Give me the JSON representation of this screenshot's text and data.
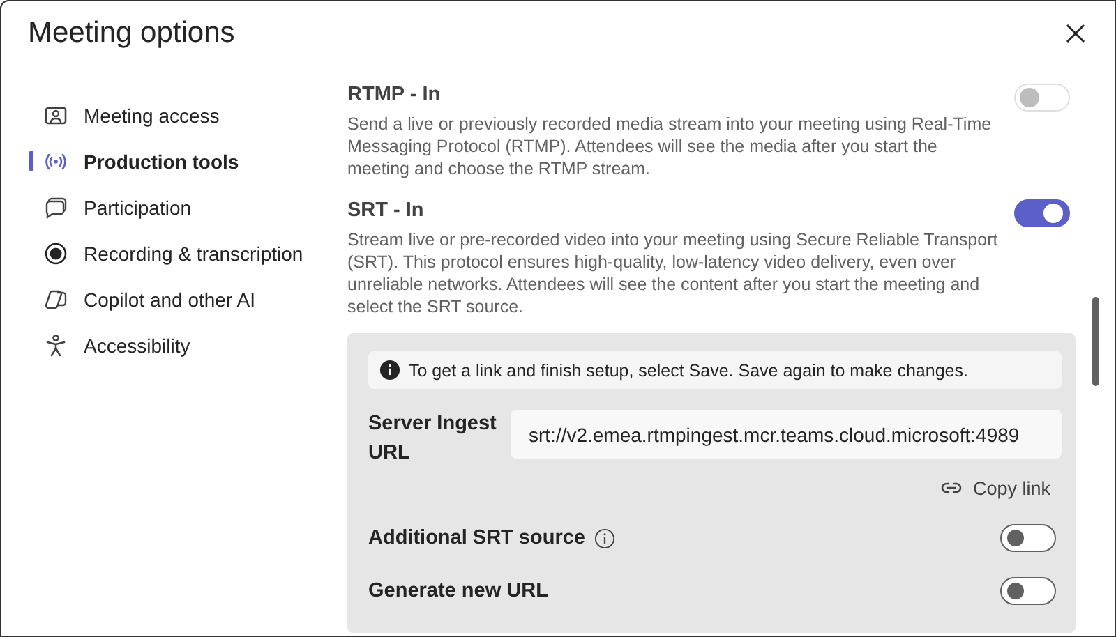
{
  "window": {
    "title": "Meeting options"
  },
  "sidebar": {
    "items": [
      {
        "label": "Meeting access",
        "kind": "access",
        "selected": false
      },
      {
        "label": "Production tools",
        "kind": "production",
        "selected": true
      },
      {
        "label": "Participation",
        "kind": "participation",
        "selected": false
      },
      {
        "label": "Recording & transcription",
        "kind": "recording",
        "selected": false
      },
      {
        "label": "Copilot and other AI",
        "kind": "ai",
        "selected": false
      },
      {
        "label": "Accessibility",
        "kind": "accessibility",
        "selected": false
      }
    ]
  },
  "sections": [
    {
      "title": "RTMP - In",
      "description": "Send a live or previously recorded media stream into your meeting using Real-Time Messaging Protocol (RTMP). Attendees will see the media after you start the meeting and choose the RTMP stream.",
      "on": false,
      "disabled": true
    },
    {
      "title": "SRT - In",
      "description": "Stream live or pre-recorded video into your meeting using Secure Reliable Transport (SRT). This protocol ensures high-quality, low-latency video delivery, even over unreliable networks. Attendees will see the content after you start the meeting and select the SRT source.",
      "on": true,
      "disabled": false
    }
  ],
  "srt_panel": {
    "notice": "To get a link and finish setup, select Save. Save again to make changes.",
    "url_field": {
      "label": "Server Ingest URL",
      "value": "srt://v2.emea.rtmpingest.mcr.teams.cloud.microsoft:4989"
    },
    "copy_link": "Copy link",
    "options": [
      {
        "label": "Additional SRT source",
        "info": true,
        "on": false
      },
      {
        "label": "Generate new URL",
        "info": false,
        "on": false
      }
    ]
  }
}
